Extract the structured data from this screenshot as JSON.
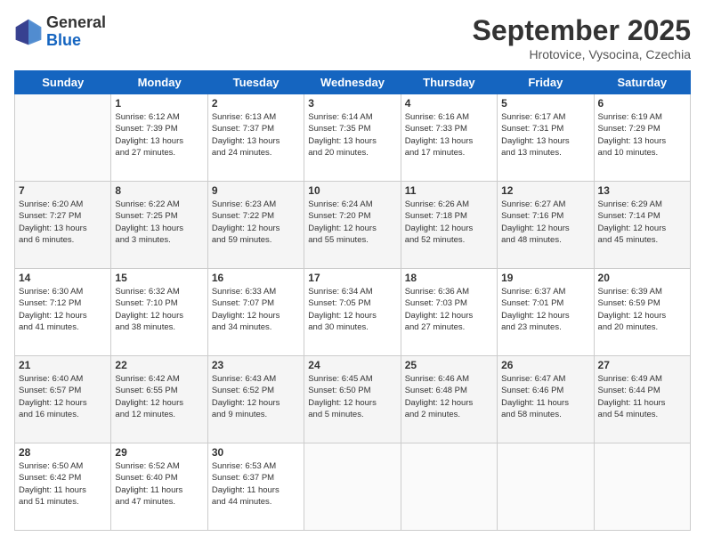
{
  "logo": {
    "general": "General",
    "blue": "Blue"
  },
  "title": "September 2025",
  "location": "Hrotovice, Vysocina, Czechia",
  "weekdays": [
    "Sunday",
    "Monday",
    "Tuesday",
    "Wednesday",
    "Thursday",
    "Friday",
    "Saturday"
  ],
  "weeks": [
    [
      {
        "day": "",
        "info": ""
      },
      {
        "day": "1",
        "info": "Sunrise: 6:12 AM\nSunset: 7:39 PM\nDaylight: 13 hours\nand 27 minutes."
      },
      {
        "day": "2",
        "info": "Sunrise: 6:13 AM\nSunset: 7:37 PM\nDaylight: 13 hours\nand 24 minutes."
      },
      {
        "day": "3",
        "info": "Sunrise: 6:14 AM\nSunset: 7:35 PM\nDaylight: 13 hours\nand 20 minutes."
      },
      {
        "day": "4",
        "info": "Sunrise: 6:16 AM\nSunset: 7:33 PM\nDaylight: 13 hours\nand 17 minutes."
      },
      {
        "day": "5",
        "info": "Sunrise: 6:17 AM\nSunset: 7:31 PM\nDaylight: 13 hours\nand 13 minutes."
      },
      {
        "day": "6",
        "info": "Sunrise: 6:19 AM\nSunset: 7:29 PM\nDaylight: 13 hours\nand 10 minutes."
      }
    ],
    [
      {
        "day": "7",
        "info": "Sunrise: 6:20 AM\nSunset: 7:27 PM\nDaylight: 13 hours\nand 6 minutes."
      },
      {
        "day": "8",
        "info": "Sunrise: 6:22 AM\nSunset: 7:25 PM\nDaylight: 13 hours\nand 3 minutes."
      },
      {
        "day": "9",
        "info": "Sunrise: 6:23 AM\nSunset: 7:22 PM\nDaylight: 12 hours\nand 59 minutes."
      },
      {
        "day": "10",
        "info": "Sunrise: 6:24 AM\nSunset: 7:20 PM\nDaylight: 12 hours\nand 55 minutes."
      },
      {
        "day": "11",
        "info": "Sunrise: 6:26 AM\nSunset: 7:18 PM\nDaylight: 12 hours\nand 52 minutes."
      },
      {
        "day": "12",
        "info": "Sunrise: 6:27 AM\nSunset: 7:16 PM\nDaylight: 12 hours\nand 48 minutes."
      },
      {
        "day": "13",
        "info": "Sunrise: 6:29 AM\nSunset: 7:14 PM\nDaylight: 12 hours\nand 45 minutes."
      }
    ],
    [
      {
        "day": "14",
        "info": "Sunrise: 6:30 AM\nSunset: 7:12 PM\nDaylight: 12 hours\nand 41 minutes."
      },
      {
        "day": "15",
        "info": "Sunrise: 6:32 AM\nSunset: 7:10 PM\nDaylight: 12 hours\nand 38 minutes."
      },
      {
        "day": "16",
        "info": "Sunrise: 6:33 AM\nSunset: 7:07 PM\nDaylight: 12 hours\nand 34 minutes."
      },
      {
        "day": "17",
        "info": "Sunrise: 6:34 AM\nSunset: 7:05 PM\nDaylight: 12 hours\nand 30 minutes."
      },
      {
        "day": "18",
        "info": "Sunrise: 6:36 AM\nSunset: 7:03 PM\nDaylight: 12 hours\nand 27 minutes."
      },
      {
        "day": "19",
        "info": "Sunrise: 6:37 AM\nSunset: 7:01 PM\nDaylight: 12 hours\nand 23 minutes."
      },
      {
        "day": "20",
        "info": "Sunrise: 6:39 AM\nSunset: 6:59 PM\nDaylight: 12 hours\nand 20 minutes."
      }
    ],
    [
      {
        "day": "21",
        "info": "Sunrise: 6:40 AM\nSunset: 6:57 PM\nDaylight: 12 hours\nand 16 minutes."
      },
      {
        "day": "22",
        "info": "Sunrise: 6:42 AM\nSunset: 6:55 PM\nDaylight: 12 hours\nand 12 minutes."
      },
      {
        "day": "23",
        "info": "Sunrise: 6:43 AM\nSunset: 6:52 PM\nDaylight: 12 hours\nand 9 minutes."
      },
      {
        "day": "24",
        "info": "Sunrise: 6:45 AM\nSunset: 6:50 PM\nDaylight: 12 hours\nand 5 minutes."
      },
      {
        "day": "25",
        "info": "Sunrise: 6:46 AM\nSunset: 6:48 PM\nDaylight: 12 hours\nand 2 minutes."
      },
      {
        "day": "26",
        "info": "Sunrise: 6:47 AM\nSunset: 6:46 PM\nDaylight: 11 hours\nand 58 minutes."
      },
      {
        "day": "27",
        "info": "Sunrise: 6:49 AM\nSunset: 6:44 PM\nDaylight: 11 hours\nand 54 minutes."
      }
    ],
    [
      {
        "day": "28",
        "info": "Sunrise: 6:50 AM\nSunset: 6:42 PM\nDaylight: 11 hours\nand 51 minutes."
      },
      {
        "day": "29",
        "info": "Sunrise: 6:52 AM\nSunset: 6:40 PM\nDaylight: 11 hours\nand 47 minutes."
      },
      {
        "day": "30",
        "info": "Sunrise: 6:53 AM\nSunset: 6:37 PM\nDaylight: 11 hours\nand 44 minutes."
      },
      {
        "day": "",
        "info": ""
      },
      {
        "day": "",
        "info": ""
      },
      {
        "day": "",
        "info": ""
      },
      {
        "day": "",
        "info": ""
      }
    ]
  ]
}
